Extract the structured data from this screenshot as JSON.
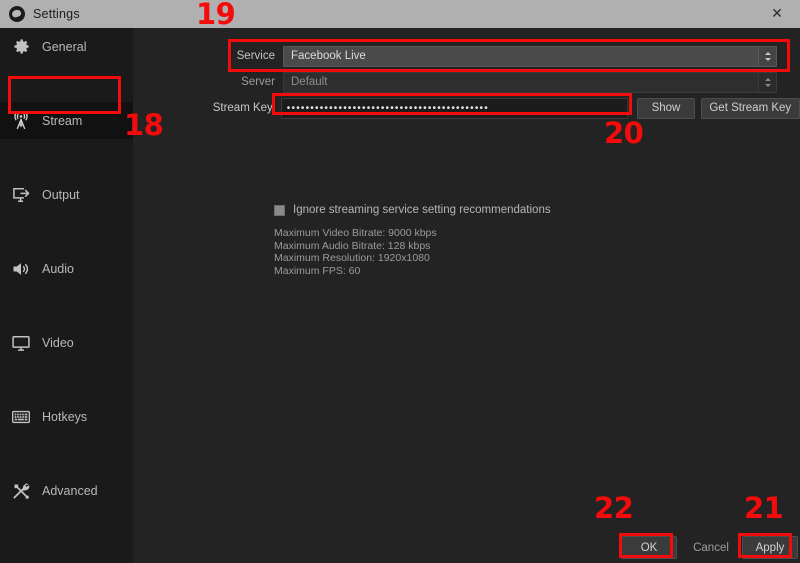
{
  "window": {
    "title": "Settings",
    "app_icon": "obs-logo-icon",
    "close_icon": "close-icon"
  },
  "sidebar": {
    "items": [
      {
        "label": "General",
        "icon": "gear-icon",
        "active": false
      },
      {
        "label": "Stream",
        "icon": "broadcast-icon",
        "active": true
      },
      {
        "label": "Output",
        "icon": "output-icon",
        "active": false
      },
      {
        "label": "Audio",
        "icon": "speaker-icon",
        "active": false
      },
      {
        "label": "Video",
        "icon": "monitor-icon",
        "active": false
      },
      {
        "label": "Hotkeys",
        "icon": "keyboard-icon",
        "active": false
      },
      {
        "label": "Advanced",
        "icon": "tools-icon",
        "active": false
      }
    ]
  },
  "stream_settings": {
    "service": {
      "label": "Service",
      "value": "Facebook Live",
      "spinner_icon": "updown-arrows-icon"
    },
    "server": {
      "label": "Server",
      "value": "Default",
      "spinner_icon": "updown-arrows-icon"
    },
    "stream_key": {
      "label": "Stream Key",
      "value": "•••••••••••••••••••••••••••••••••••••••••••",
      "placeholder": "",
      "show_button": "Show",
      "get_key_button": "Get Stream Key"
    },
    "ignore_recommendations": {
      "label": "Ignore streaming service setting recommendations",
      "checked": false
    },
    "recommendations": [
      "Maximum Video Bitrate: 9000 kbps",
      "Maximum Audio Bitrate: 128 kbps",
      "Maximum Resolution: 1920x1080",
      "Maximum FPS: 60"
    ]
  },
  "footer": {
    "ok": "OK",
    "cancel": "Cancel",
    "apply": "Apply"
  },
  "annotations": {
    "color": "#f40b0b",
    "numbers": [
      "19",
      "18",
      "20",
      "22",
      "21"
    ]
  }
}
